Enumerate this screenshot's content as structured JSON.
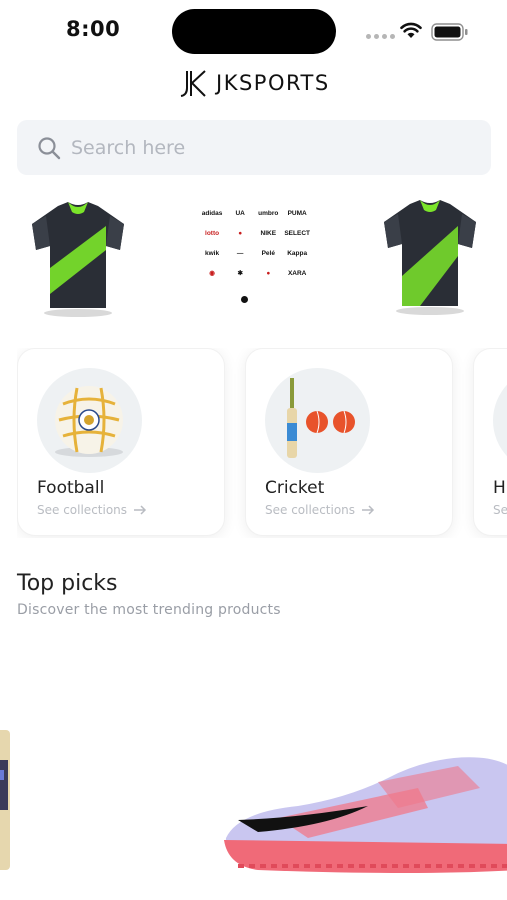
{
  "status_bar": {
    "time": "8:00"
  },
  "header": {
    "logo_mark": "JK",
    "brand": "JKSPORTS"
  },
  "search": {
    "placeholder": "Search here"
  },
  "banner": {
    "brands": [
      "adidas",
      "UA",
      "umbro",
      "PUMA",
      "lotto",
      "",
      "kwik",
      "NIKE",
      "SELECT",
      "",
      "",
      "",
      "Pelé",
      "",
      "Kappa",
      "",
      "",
      "",
      "",
      "XARA",
      "",
      ""
    ]
  },
  "categories": [
    {
      "title": "Football",
      "link": "See collections"
    },
    {
      "title": "Cricket",
      "link": "See collections"
    },
    {
      "title": "H",
      "link": "Se"
    }
  ],
  "top_picks": {
    "title": "Top picks",
    "subtitle": "Discover the most trending products"
  },
  "colors": {
    "accent_green": "#7be52a",
    "jersey_dark": "#2a2e36",
    "cricket_ball": "#e8532b",
    "shoe_pink": "#f06a78",
    "shoe_lavender": "#c9c6f0"
  }
}
